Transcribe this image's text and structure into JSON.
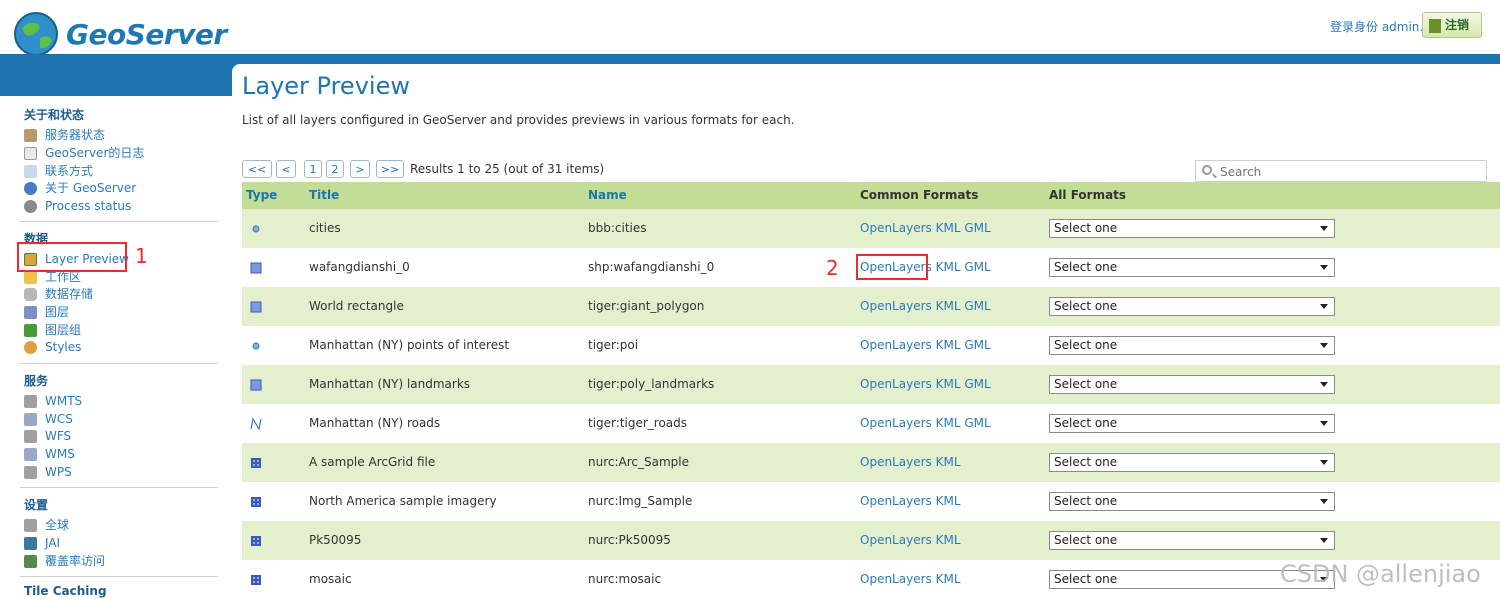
{
  "header": {
    "app_name": "GeoServer",
    "login_text": "登录身份 admin.",
    "logout_label": "注销"
  },
  "sidebar": {
    "sections": [
      {
        "heading": "关于和状态",
        "items": [
          "服务器状态",
          "GeoServer的日志",
          "联系方式",
          "关于 GeoServer",
          "Process status"
        ]
      },
      {
        "heading": "数据",
        "items": [
          "Layer Preview",
          "工作区",
          "数据存储",
          "图层",
          "图层组",
          "Styles"
        ]
      },
      {
        "heading": "服务",
        "items": [
          "WMTS",
          "WCS",
          "WFS",
          "WMS",
          "WPS"
        ]
      },
      {
        "heading": "设置",
        "items": [
          "全球",
          "JAI",
          "覆盖率访问"
        ]
      },
      {
        "heading": "Tile Caching",
        "items": []
      }
    ]
  },
  "main": {
    "title": "Layer Preview",
    "description": "List of all layers configured in GeoServer and provides previews in various formats for each.",
    "pager": {
      "first": "<<",
      "prev": "<",
      "page1": "1",
      "page2": "2",
      "next": ">",
      "last": ">>"
    },
    "results_text": "Results 1 to 25 (out of 31 items)",
    "search_placeholder": "Search",
    "columns": {
      "type": "Type",
      "title": "Title",
      "name": "Name",
      "common": "Common Formats",
      "all": "All Formats"
    },
    "rows": [
      {
        "type": "point",
        "title": "cities",
        "name": "bbb:cities",
        "formats": [
          "OpenLayers",
          "KML",
          "GML"
        ],
        "select": "Select one"
      },
      {
        "type": "polygon",
        "title": "wafangdianshi_0",
        "name": "shp:wafangdianshi_0",
        "formats": [
          "OpenLayers",
          "KML",
          "GML"
        ],
        "select": "Select one"
      },
      {
        "type": "polygon",
        "title": "World rectangle",
        "name": "tiger:giant_polygon",
        "formats": [
          "OpenLayers",
          "KML",
          "GML"
        ],
        "select": "Select one"
      },
      {
        "type": "point",
        "title": "Manhattan (NY) points of interest",
        "name": "tiger:poi",
        "formats": [
          "OpenLayers",
          "KML",
          "GML"
        ],
        "select": "Select one"
      },
      {
        "type": "polygon",
        "title": "Manhattan (NY) landmarks",
        "name": "tiger:poly_landmarks",
        "formats": [
          "OpenLayers",
          "KML",
          "GML"
        ],
        "select": "Select one"
      },
      {
        "type": "line",
        "title": "Manhattan (NY) roads",
        "name": "tiger:tiger_roads",
        "formats": [
          "OpenLayers",
          "KML",
          "GML"
        ],
        "select": "Select one"
      },
      {
        "type": "raster",
        "title": "A sample ArcGrid file",
        "name": "nurc:Arc_Sample",
        "formats": [
          "OpenLayers",
          "KML"
        ],
        "select": "Select one"
      },
      {
        "type": "raster",
        "title": "North America sample imagery",
        "name": "nurc:Img_Sample",
        "formats": [
          "OpenLayers",
          "KML"
        ],
        "select": "Select one"
      },
      {
        "type": "raster",
        "title": "Pk50095",
        "name": "nurc:Pk50095",
        "formats": [
          "OpenLayers",
          "KML"
        ],
        "select": "Select one"
      },
      {
        "type": "raster",
        "title": "mosaic",
        "name": "nurc:mosaic",
        "formats": [
          "OpenLayers",
          "KML"
        ],
        "select": "Select one"
      }
    ]
  },
  "annotations": {
    "label_1": "1",
    "label_2": "2"
  },
  "watermark": "CSDN @allenjiao",
  "colors": {
    "accent": "#1e74ad",
    "header_row": "#c2dd94",
    "odd_row": "#e4efce",
    "annotation": "#e53030"
  }
}
